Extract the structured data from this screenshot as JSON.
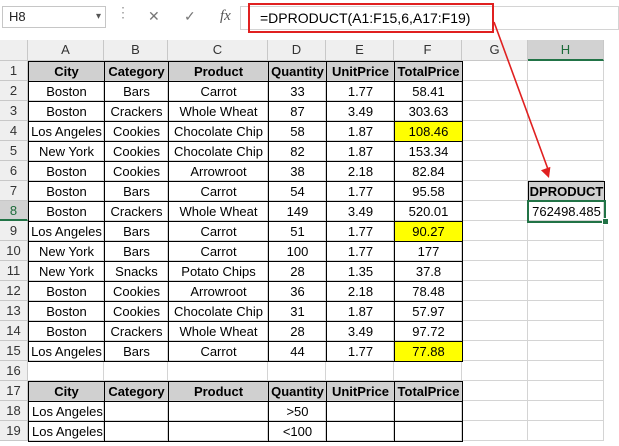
{
  "formula_bar": {
    "name_box": "H8",
    "cancel_icon": "✕",
    "enter_icon": "✓",
    "fx_label": "fx",
    "formula": "=DPRODUCT(A1:F15,6,A17:F19)"
  },
  "columns": [
    "A",
    "B",
    "C",
    "D",
    "E",
    "F",
    "G",
    "H"
  ],
  "rows": [
    "1",
    "2",
    "3",
    "4",
    "5",
    "6",
    "7",
    "8",
    "9",
    "10",
    "11",
    "12",
    "13",
    "14",
    "15",
    "16",
    "17",
    "18",
    "19"
  ],
  "table": {
    "headers": [
      "City",
      "Category",
      "Product",
      "Quantity",
      "UnitPrice",
      "TotalPrice"
    ],
    "rows": [
      [
        "Boston",
        "Bars",
        "Carrot",
        "33",
        "1.77",
        "58.41"
      ],
      [
        "Boston",
        "Crackers",
        "Whole Wheat",
        "87",
        "3.49",
        "303.63"
      ],
      [
        "Los Angeles",
        "Cookies",
        "Chocolate Chip",
        "58",
        "1.87",
        "108.46"
      ],
      [
        "New York",
        "Cookies",
        "Chocolate Chip",
        "82",
        "1.87",
        "153.34"
      ],
      [
        "Boston",
        "Cookies",
        "Arrowroot",
        "38",
        "2.18",
        "82.84"
      ],
      [
        "Boston",
        "Bars",
        "Carrot",
        "54",
        "1.77",
        "95.58"
      ],
      [
        "Boston",
        "Crackers",
        "Whole Wheat",
        "149",
        "3.49",
        "520.01"
      ],
      [
        "Los Angeles",
        "Bars",
        "Carrot",
        "51",
        "1.77",
        "90.27"
      ],
      [
        "New York",
        "Bars",
        "Carrot",
        "100",
        "1.77",
        "177"
      ],
      [
        "New York",
        "Snacks",
        "Potato Chips",
        "28",
        "1.35",
        "37.8"
      ],
      [
        "Boston",
        "Cookies",
        "Arrowroot",
        "36",
        "2.18",
        "78.48"
      ],
      [
        "Boston",
        "Cookies",
        "Chocolate Chip",
        "31",
        "1.87",
        "57.97"
      ],
      [
        "Boston",
        "Crackers",
        "Whole Wheat",
        "28",
        "3.49",
        "97.72"
      ],
      [
        "Los Angeles",
        "Bars",
        "Carrot",
        "44",
        "1.77",
        "77.88"
      ]
    ],
    "highlighted_total_rows": [
      2,
      7,
      13
    ]
  },
  "criteria": {
    "headers": [
      "City",
      "Category",
      "Product",
      "Quantity",
      "UnitPrice",
      "TotalPrice"
    ],
    "rows": [
      [
        "Los Angeles",
        "",
        "",
        ">50",
        "",
        ""
      ],
      [
        "Los Angeles",
        "",
        "",
        "<100",
        "",
        ""
      ]
    ]
  },
  "result": {
    "label": "DPRODUCT",
    "value": "762498.485"
  },
  "colors": {
    "highlight": "#ffff00",
    "arrow": "#e02020",
    "selection": "#217346"
  }
}
